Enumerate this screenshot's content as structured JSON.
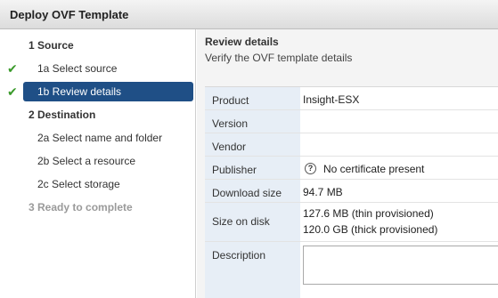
{
  "window": {
    "title": "Deploy OVF Template"
  },
  "sidebar": {
    "steps": [
      {
        "label": "1  Source",
        "state": "section"
      },
      {
        "label": "1a  Select source",
        "state": "completed"
      },
      {
        "label": "1b  Review details",
        "state": "selected-completed"
      },
      {
        "label": "2  Destination",
        "state": "section"
      },
      {
        "label": "2a  Select name and folder",
        "state": "pending"
      },
      {
        "label": "2b  Select a resource",
        "state": "pending"
      },
      {
        "label": "2c  Select storage",
        "state": "pending"
      },
      {
        "label": "3  Ready to complete",
        "state": "disabled"
      }
    ],
    "check_icon": "checkmark-icon",
    "check_color": "#3a9a2a",
    "selected_color": "#1f4f86"
  },
  "main": {
    "title": "Review details",
    "subtitle": "Verify the OVF template details",
    "details": [
      {
        "key": "Product",
        "value": "Insight-ESX"
      },
      {
        "key": "Version",
        "value": ""
      },
      {
        "key": "Vendor",
        "value": ""
      },
      {
        "key": "Publisher",
        "value": "No certificate present",
        "icon": "question-icon"
      },
      {
        "key": "Download size",
        "value": "94.7 MB"
      },
      {
        "key": "Size on disk",
        "value": "127.6 MB (thin provisioned)",
        "value2": "120.0 GB (thick provisioned)"
      },
      {
        "key": "Description",
        "value": ""
      }
    ]
  }
}
